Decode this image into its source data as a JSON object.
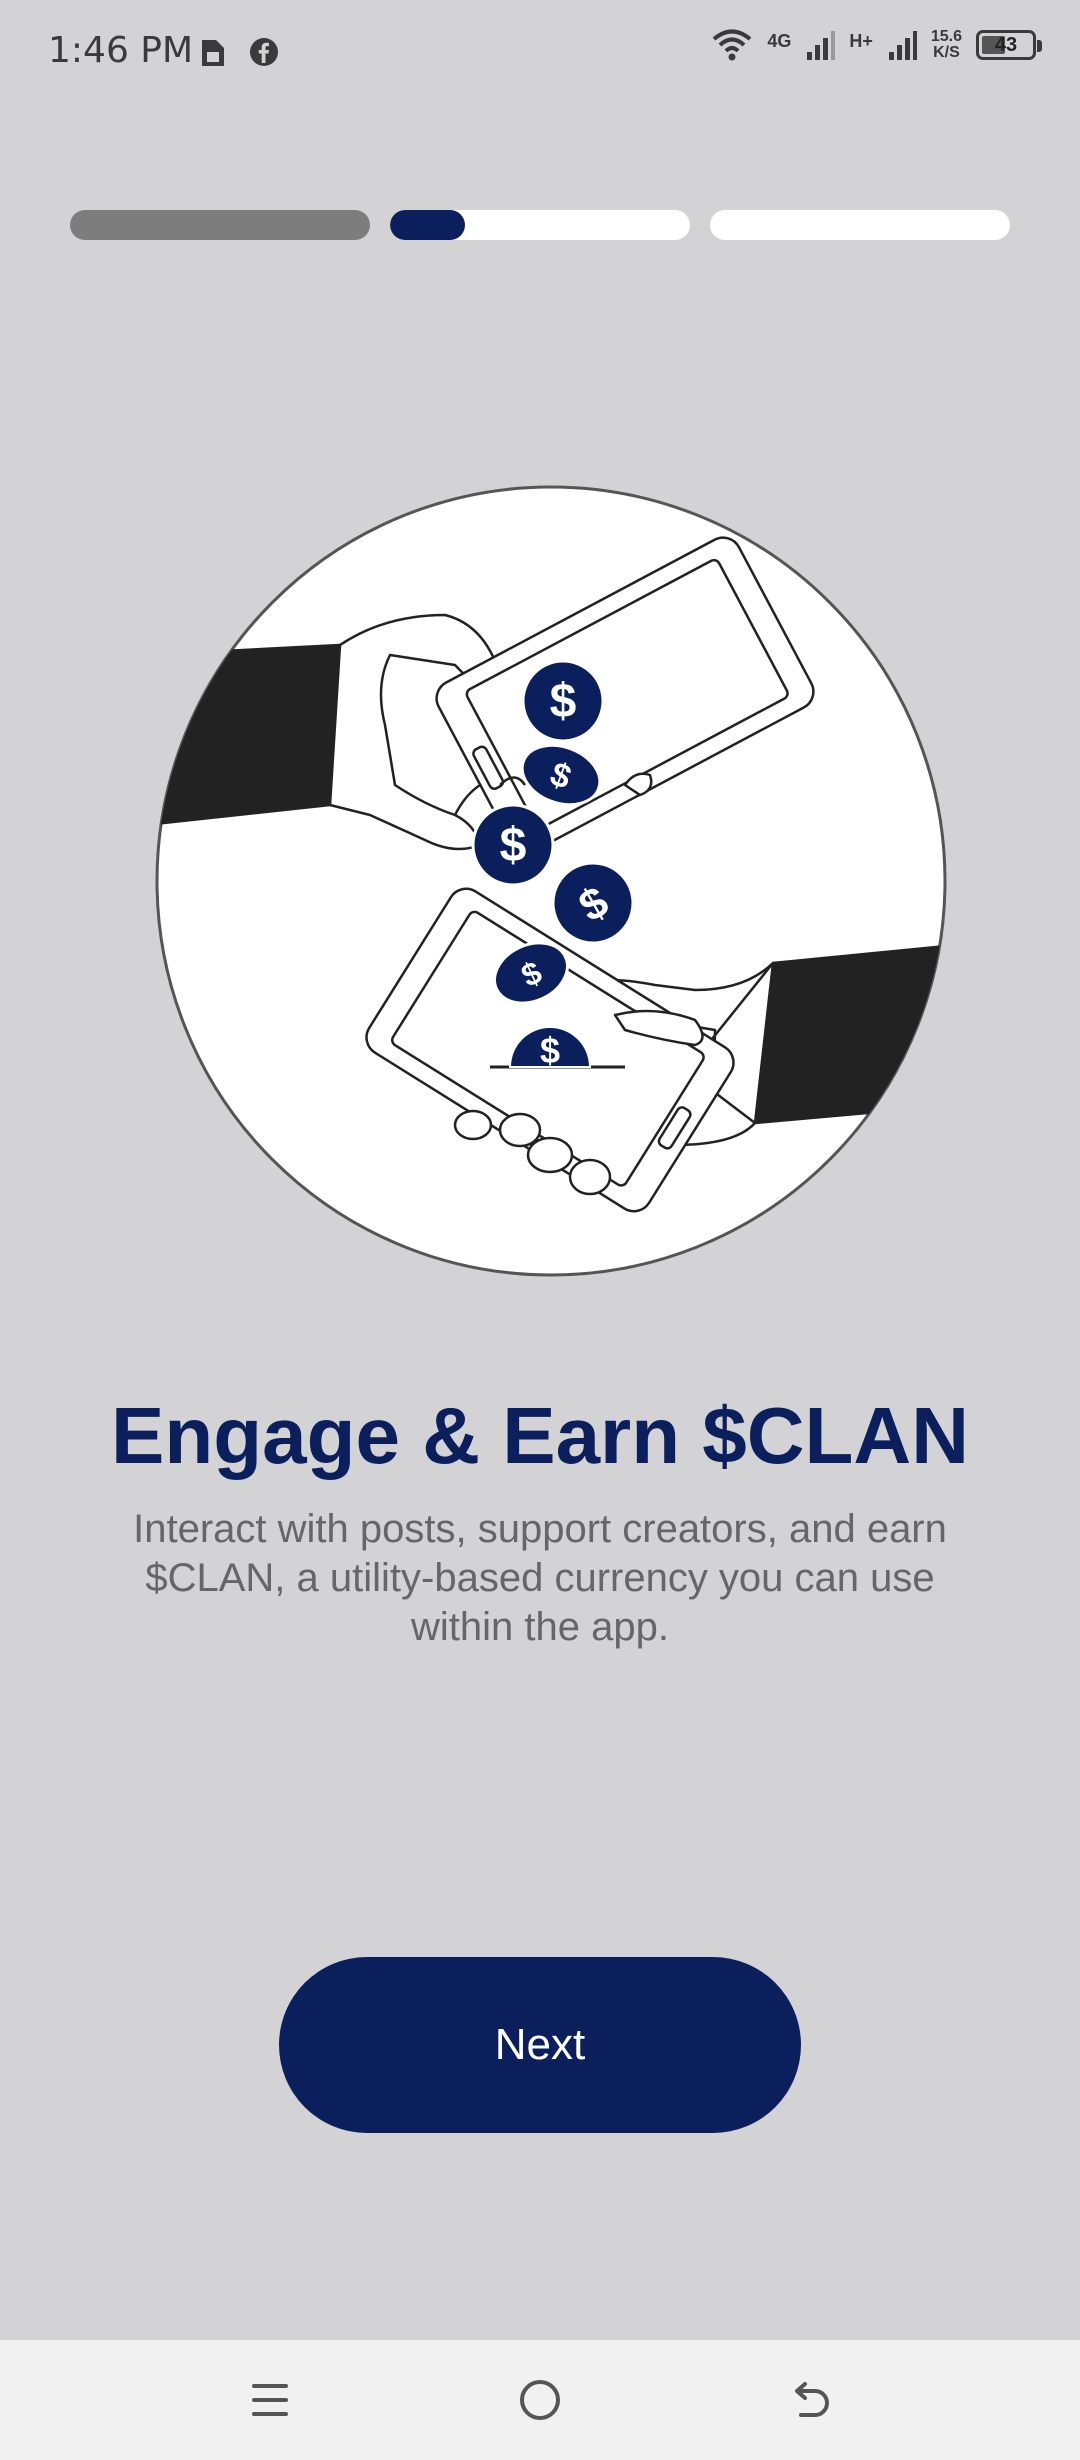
{
  "status_bar": {
    "time": "1:46 PM",
    "icons_left": [
      "sim-card-icon",
      "facebook-icon"
    ],
    "network_1": "4G",
    "network_2": "H+",
    "speed_value": "15.6",
    "speed_unit": "K/S",
    "battery": "43"
  },
  "progress": {
    "segments": 3,
    "current_index": 1,
    "current_fill_fraction": 0.25
  },
  "onboarding": {
    "title": "Engage & Earn $CLAN",
    "description": "Interact with posts, support creators, and earn $CLAN, a utility-based currency you can use within the app.",
    "next_label": "Next"
  },
  "illustration": {
    "name": "hands-exchanging-phones-coins-illustration",
    "coin_symbol": "$"
  },
  "nav_bar": {
    "icons": [
      "menu-icon",
      "home-icon",
      "back-icon"
    ]
  },
  "colors": {
    "background": "#d3d3d5",
    "accent": "#0b1f5c",
    "segment_done": "#7d7d7d",
    "segment_empty": "#ffffff",
    "nav_background": "#f1f1f1"
  }
}
